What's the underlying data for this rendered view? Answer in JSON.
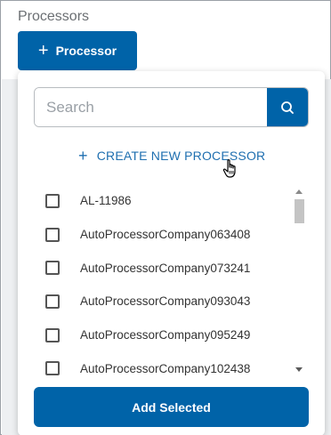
{
  "section": {
    "title": "Processors"
  },
  "toolbar": {
    "add_processor_icon": "+",
    "add_processor_label": "Processor"
  },
  "panel": {
    "search": {
      "placeholder": "Search",
      "value": ""
    },
    "create_new": {
      "icon": "+",
      "label": "CREATE NEW PROCESSOR"
    },
    "items": [
      {
        "label": "AL-11986",
        "checked": false
      },
      {
        "label": "AutoProcessorCompany063408",
        "checked": false
      },
      {
        "label": "AutoProcessorCompany073241",
        "checked": false
      },
      {
        "label": "AutoProcessorCompany093043",
        "checked": false
      },
      {
        "label": "AutoProcessorCompany095249",
        "checked": false
      },
      {
        "label": "AutoProcessorCompany102438",
        "checked": false
      }
    ],
    "add_selected_label": "Add Selected"
  },
  "colors": {
    "primary": "#0063a8",
    "link": "#1f6fb0"
  }
}
